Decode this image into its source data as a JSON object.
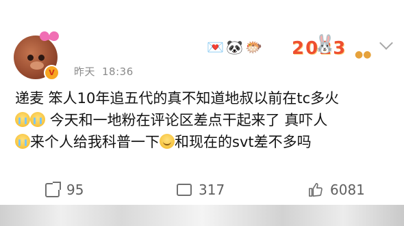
{
  "post": {
    "author_avatar": "pig-with-bow-avatar",
    "verified_badge": "V",
    "time_label": "昨天",
    "time_value": "18:36",
    "decorations": [
      "heart-mail-icon",
      "panda-icon",
      "puffer-fish-icon",
      "2023-rabbit-card"
    ],
    "card_text": "2023",
    "content_lines": [
      {
        "parts": [
          "递麦 笨人10年追五代的真不知道地叔以前在tc多火"
        ]
      },
      {
        "parts": [
          "cry-emoji",
          "cry-emoji",
          "今天和一地粉在评论区差点干起来了 真吓人"
        ]
      },
      {
        "parts": [
          "cry-emoji",
          "来个人给我科普一下",
          "smile-emoji",
          "和现在的svt差不多吗"
        ]
      }
    ],
    "line1": "递麦 笨人10年追五代的真不知道地叔以前在tc多火",
    "line2": "今天和一地粉在评论区差点干起来了 真吓人",
    "line3a": "来个人给我科普一下",
    "line3b": "和现在的svt差不多吗"
  },
  "actions": {
    "repost_count": "95",
    "comment_count": "317",
    "like_count": "6081"
  },
  "colors": {
    "meta_text": "#8a8a8a",
    "body_text": "#121212",
    "action_text": "#5f5f5f",
    "badge": "#f7a622"
  }
}
